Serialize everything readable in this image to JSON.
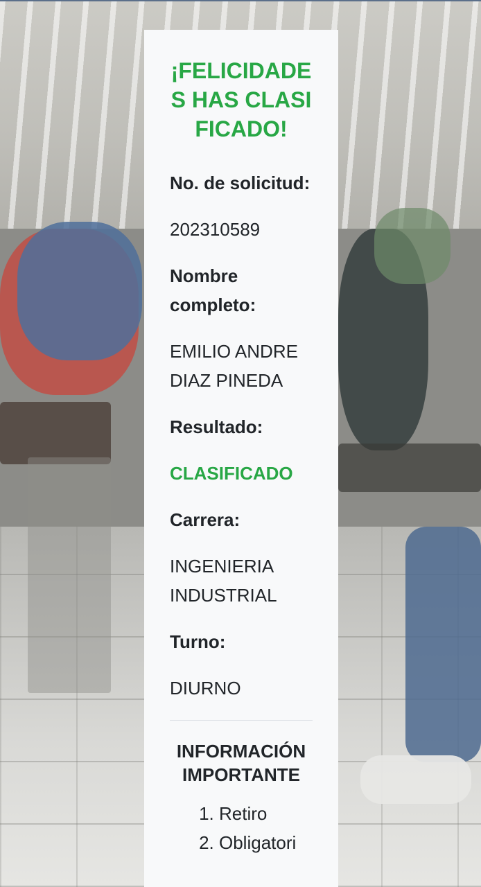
{
  "card": {
    "title": "¡FELICIDADES HAS CLASIFICADO!",
    "fields": {
      "solicitud": {
        "label": "No. de solicitud:",
        "value": "202310589"
      },
      "nombre": {
        "label": "Nombre completo:",
        "value": "EMILIO ANDRE DIAZ PINEDA"
      },
      "resultado": {
        "label": "Resultado:",
        "value": "CLASIFICADO"
      },
      "carrera": {
        "label": "Carrera:",
        "value": "INGENIERIA INDUSTRIAL"
      },
      "turno": {
        "label": "Turno:",
        "value": "DIURNO"
      }
    },
    "info": {
      "title": "INFORMACIÓN IMPORTANTE",
      "items": [
        "Retiro",
        "Obligatori"
      ]
    }
  },
  "colors": {
    "accent_green": "#28a745",
    "card_bg": "#f8f9fa",
    "text": "#212529"
  }
}
